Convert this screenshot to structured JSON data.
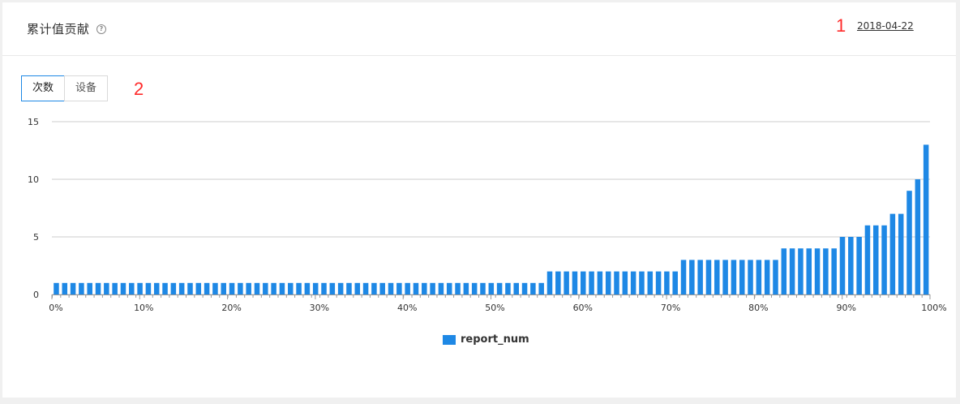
{
  "header": {
    "title": "累计值贡献",
    "help_icon": "?",
    "date": "2018-04-22"
  },
  "annotations": {
    "a1": "1",
    "a2": "2"
  },
  "tabs": [
    {
      "label": "次数",
      "active": true
    },
    {
      "label": "设备",
      "active": false
    }
  ],
  "colors": {
    "bar": "#1e88e5",
    "grid": "#cccccc",
    "axis": "#999999"
  },
  "chart_data": {
    "type": "bar",
    "ylim": [
      0,
      15
    ],
    "yticks": [
      "0",
      "5",
      "10",
      "15"
    ],
    "xticks": [
      "0%",
      "10%",
      "20%",
      "30%",
      "40%",
      "50%",
      "60%",
      "70%",
      "80%",
      "90%",
      "100%"
    ],
    "legend": "report_num",
    "legend_position": "bottom-center",
    "series": [
      {
        "name": "report_num",
        "values": [
          1,
          1,
          1,
          1,
          1,
          1,
          1,
          1,
          1,
          1,
          1,
          1,
          1,
          1,
          1,
          1,
          1,
          1,
          1,
          1,
          1,
          1,
          1,
          1,
          1,
          1,
          1,
          1,
          1,
          1,
          1,
          1,
          1,
          1,
          1,
          1,
          1,
          1,
          1,
          1,
          1,
          1,
          1,
          1,
          1,
          1,
          1,
          1,
          1,
          1,
          1,
          1,
          1,
          1,
          1,
          1,
          1,
          1,
          1,
          2,
          2,
          2,
          2,
          2,
          2,
          2,
          2,
          2,
          2,
          2,
          2,
          2,
          2,
          2,
          2,
          3,
          3,
          3,
          3,
          3,
          3,
          3,
          3,
          3,
          3,
          3,
          3,
          4,
          4,
          4,
          4,
          4,
          4,
          4,
          5,
          5,
          5,
          6,
          6,
          6,
          7,
          7,
          9,
          10,
          13
        ]
      }
    ]
  }
}
